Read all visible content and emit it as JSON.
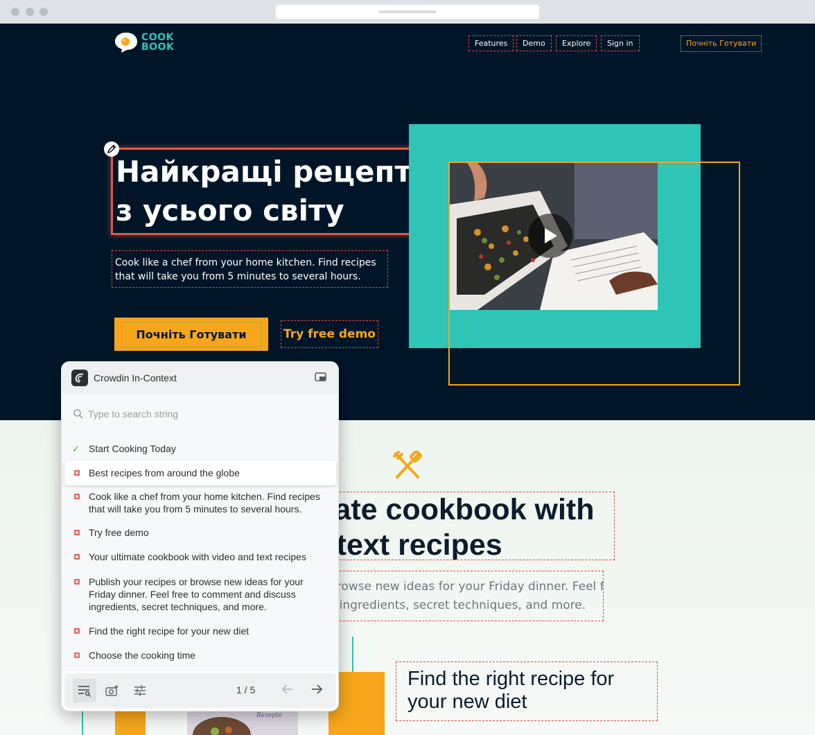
{
  "site": {
    "logo_text_line1": "COOK",
    "logo_text_line2": "BOOK",
    "nav": [
      "Features",
      "Demo",
      "Explore",
      "Sign in"
    ],
    "nav_cta": "Почніть Готувати"
  },
  "hero": {
    "title_line1": "Найкращі рецепти",
    "title_line2": "з усього світу",
    "subtitle_line1": "Cook like a chef from your home kitchen. Find recipes",
    "subtitle_line2": "that will take you from 5 minutes to several hours.",
    "primary_button": "Почніть Готувати",
    "secondary_button": "Try free demo"
  },
  "section": {
    "title_line1": "Your ultimate cookbook with",
    "title_line2": "video and text recipes",
    "subtitle_line1": "Publish your recipes or browse new ideas for your Friday dinner. Feel free",
    "subtitle_line2": "to comment and discuss ingredients, secret techniques, and more.",
    "feature_title_line1": "Find the right recipe for",
    "feature_title_line2": "your new diet"
  },
  "crowdin": {
    "title": "Crowdin In-Context",
    "search_placeholder": "Type to search string",
    "strings": [
      {
        "text": "Start Cooking Today",
        "status": "translated"
      },
      {
        "text": "Best recipes from around the globe",
        "status": "untranslated",
        "active": true
      },
      {
        "text": "Cook like a chef from your home kitchen. Find recipes that will take you from 5 minutes to several hours.",
        "status": "untranslated"
      },
      {
        "text": "Try free demo",
        "status": "untranslated"
      },
      {
        "text": "Your ultimate cookbook with video and text recipes",
        "status": "untranslated"
      },
      {
        "text": "Publish your recipes or browse new ideas for your Friday dinner. Feel free to comment and discuss ingredients, secret techniques, and more.",
        "status": "untranslated"
      },
      {
        "text": "Find the right recipe for your new diet",
        "status": "untranslated"
      },
      {
        "text": "Choose the cooking time",
        "status": "untranslated"
      }
    ],
    "pager": "1 / 5"
  },
  "colors": {
    "hero_bg": "#001628",
    "teal": "#2ec4b6",
    "orange": "#f7a61b",
    "highlight_red": "#e05a47"
  }
}
